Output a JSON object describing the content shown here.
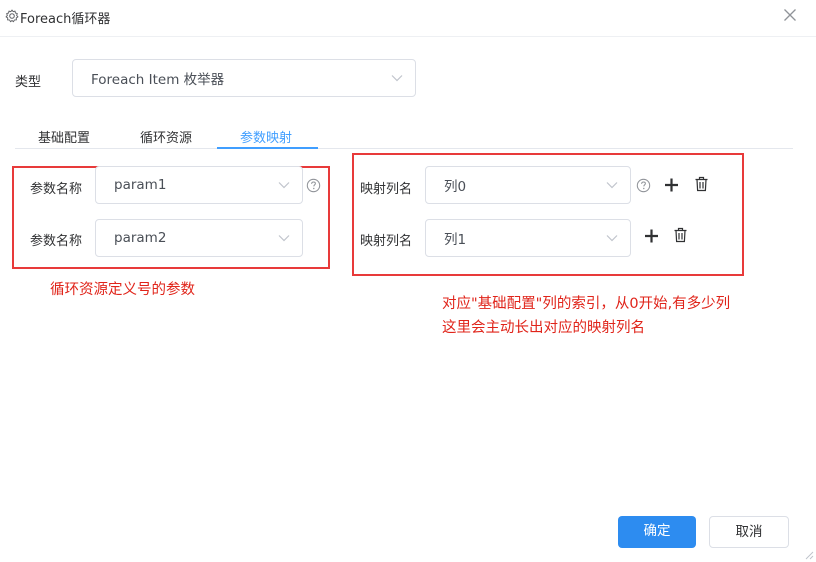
{
  "dialog": {
    "title": "Foreach循环器"
  },
  "type_field": {
    "label": "类型",
    "value": "Foreach Item 枚举器"
  },
  "tabs": [
    {
      "label": "基础配置",
      "active": false
    },
    {
      "label": "循环资源",
      "active": false
    },
    {
      "label": "参数映射",
      "active": true
    }
  ],
  "params": [
    {
      "label": "参数名称",
      "value": "param1"
    },
    {
      "label": "参数名称",
      "value": "param2"
    }
  ],
  "mappings": [
    {
      "label": "映射列名",
      "value": "列0"
    },
    {
      "label": "映射列名",
      "value": "列1"
    }
  ],
  "annotations": {
    "left": "循环资源定义号的参数",
    "right_line1": "对应\"基础配置\"列的索引，从0开始,有多少列",
    "right_line2": "这里会主动长出对应的映射列名"
  },
  "footer": {
    "confirm_label": "确定",
    "cancel_label": "取消"
  },
  "colors": {
    "accent": "#409eff",
    "primary_button": "#2d8cf0",
    "annotation_red": "#e0241a"
  }
}
